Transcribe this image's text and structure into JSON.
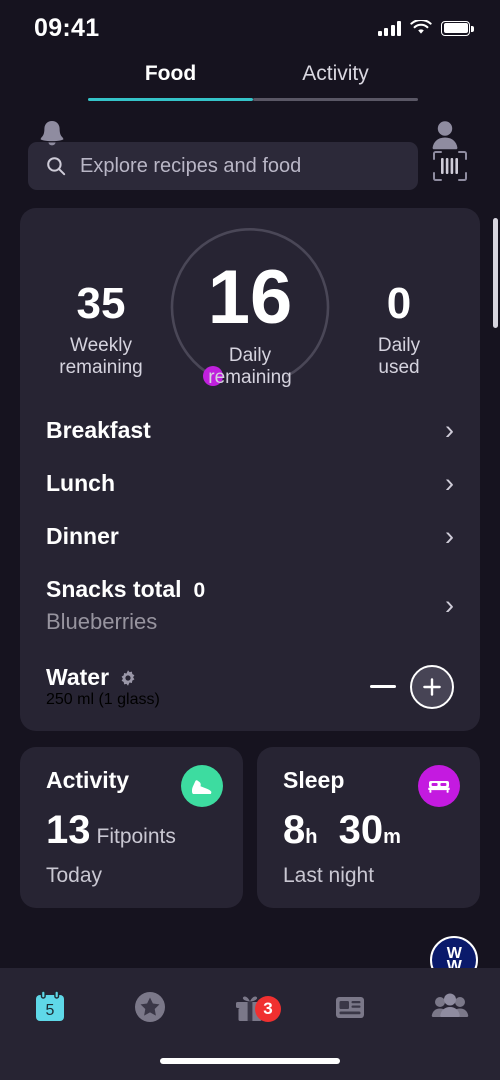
{
  "status_bar": {
    "time": "09:41",
    "signal_icon": "signal-bars-icon",
    "wifi_icon": "wifi-icon",
    "battery_icon": "battery-icon"
  },
  "header": {
    "bell_icon": "notification-bell-icon",
    "avatar_icon": "profile-avatar-icon",
    "tabs": [
      {
        "label": "Food",
        "active": true
      },
      {
        "label": "Activity",
        "active": false
      }
    ],
    "active_underline_color": "#35c4c9"
  },
  "search": {
    "placeholder": "Explore recipes and food",
    "search_icon": "search-icon",
    "barcode_icon": "barcode-scanner-icon"
  },
  "points_summary": {
    "weekly": {
      "value": "35",
      "label": "Weekly\nremaining",
      "label_line1": "Weekly",
      "label_line2": "remaining"
    },
    "daily_remaining": {
      "value": "16",
      "label_line1": "Daily",
      "label_line2": "remaining"
    },
    "daily_used": {
      "value": "0",
      "label_line1": "Daily",
      "label_line2": "used"
    },
    "ring_track_color": "#4a4757",
    "ring_marker_color": "#c020dd"
  },
  "meals": [
    {
      "title": "Breakfast",
      "subtitle": "",
      "count": "",
      "chevron": "chevron-right-icon"
    },
    {
      "title": "Lunch",
      "subtitle": "",
      "count": "",
      "chevron": "chevron-right-icon"
    },
    {
      "title": "Dinner",
      "subtitle": "",
      "count": "",
      "chevron": "chevron-right-icon"
    },
    {
      "title": "Snacks total",
      "subtitle": "Blueberries",
      "count": "0",
      "chevron": "chevron-right-icon"
    }
  ],
  "water": {
    "title": "Water",
    "gear_icon": "gear-icon",
    "amount": "250 ml (1 glass)",
    "decrease_label": "minus-button",
    "increase_label": "plus-button"
  },
  "tiles": [
    {
      "title": "Activity",
      "value": "13",
      "value_unit": "",
      "value_suffix": "Fitpoints",
      "footer": "Today",
      "icon": "running-shoe-icon",
      "icon_color": "#3ddca0"
    },
    {
      "title": "Sleep",
      "value": "8",
      "value_unit": "h",
      "value2": "30",
      "value2_unit": "m",
      "footer": "Last night",
      "icon": "bed-icon",
      "icon_color": "#c41ae0"
    }
  ],
  "bottom_nav": [
    {
      "name": "calendar",
      "icon": "calendar-icon",
      "day": "5",
      "badge": "",
      "active": true
    },
    {
      "name": "favorites",
      "icon": "star-circle-icon",
      "badge": "",
      "active": false
    },
    {
      "name": "rewards",
      "icon": "gift-icon",
      "badge": "3",
      "active": false
    },
    {
      "name": "articles",
      "icon": "news-article-icon",
      "badge": "",
      "active": false
    },
    {
      "name": "community",
      "icon": "people-group-icon",
      "badge": "",
      "active": false
    }
  ],
  "brand": {
    "logo_line1": "W",
    "logo_line2": "W",
    "logo_bg": "#0a1a6b"
  }
}
